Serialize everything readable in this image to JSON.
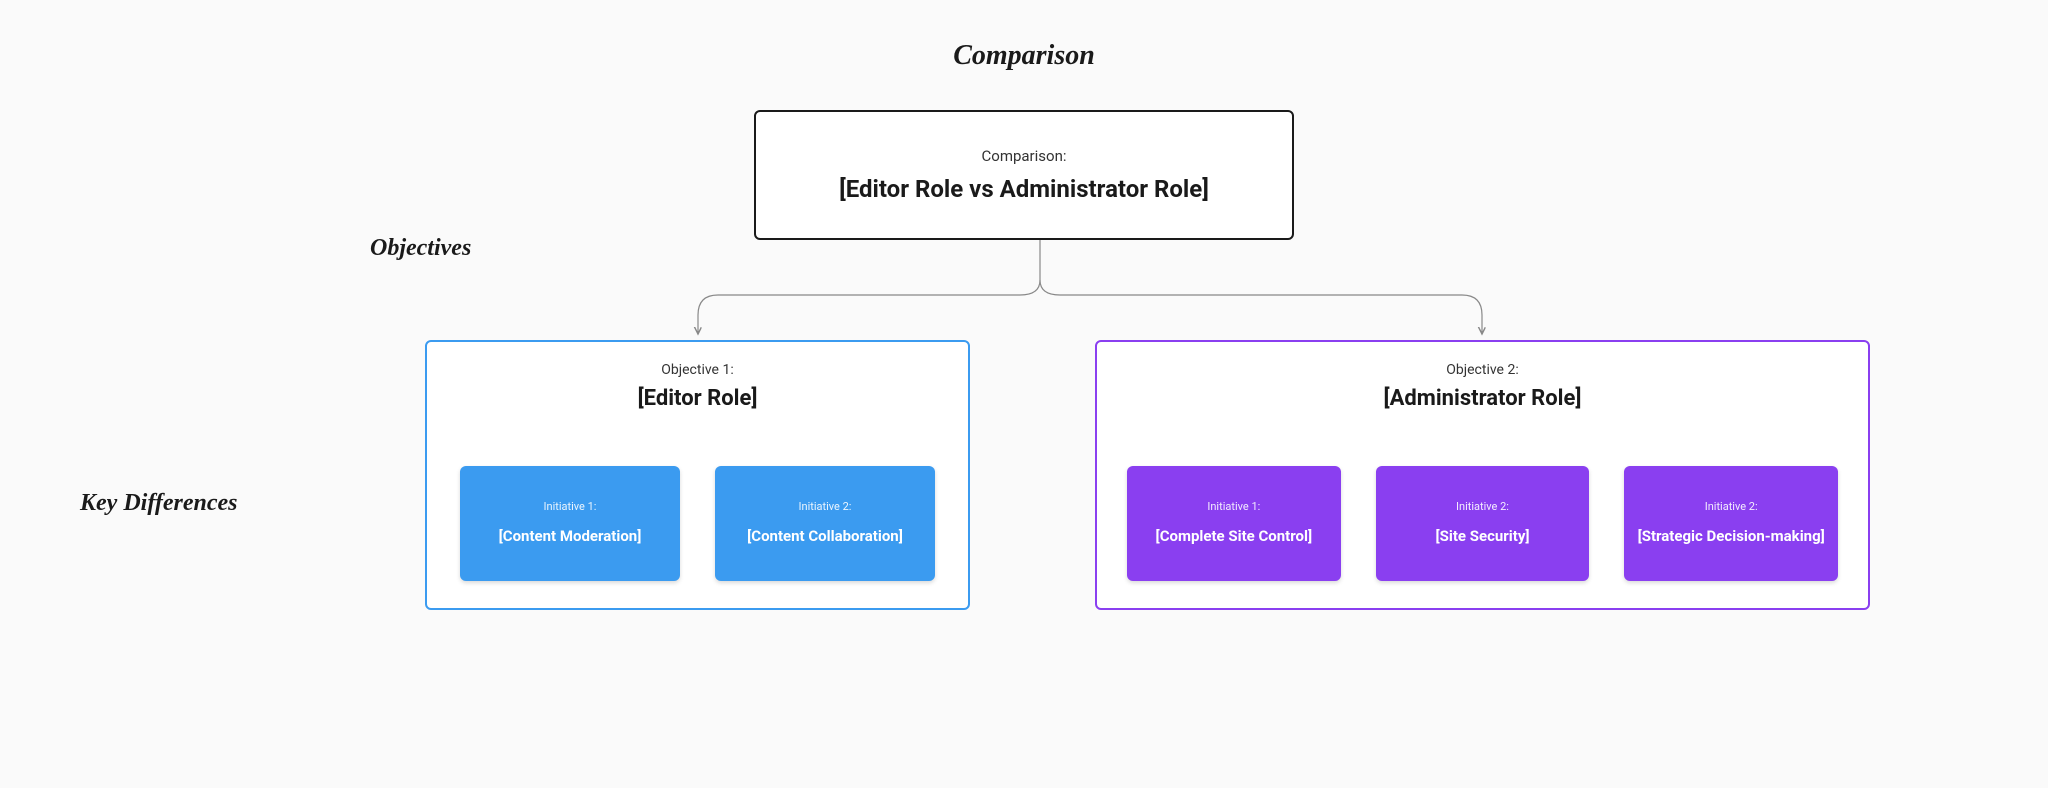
{
  "labels": {
    "comparison": "Comparison",
    "objectives": "Objectives",
    "key_differences": "Key Differences"
  },
  "comparison": {
    "sup": "Comparison:",
    "title": "[Editor Role vs Administrator Role]"
  },
  "objectives": {
    "left": {
      "sup": "Objective 1:",
      "title": "[Editor Role]",
      "color": "#3b9bf0",
      "initiatives": [
        {
          "sup": "Initiative 1:",
          "title": "[Content Moderation]"
        },
        {
          "sup": "Initiative 2:",
          "title": "[Content Collaboration]"
        }
      ]
    },
    "right": {
      "sup": "Objective 2:",
      "title": "[Administrator Role]",
      "color": "#8a3ff0",
      "initiatives": [
        {
          "sup": "Initiative 1:",
          "title": "[Complete Site Control]"
        },
        {
          "sup": "Initiative 2:",
          "title": "[Site Security]"
        },
        {
          "sup": "Initiative 2:",
          "title": "[Strategic Decision-making]"
        }
      ]
    }
  }
}
